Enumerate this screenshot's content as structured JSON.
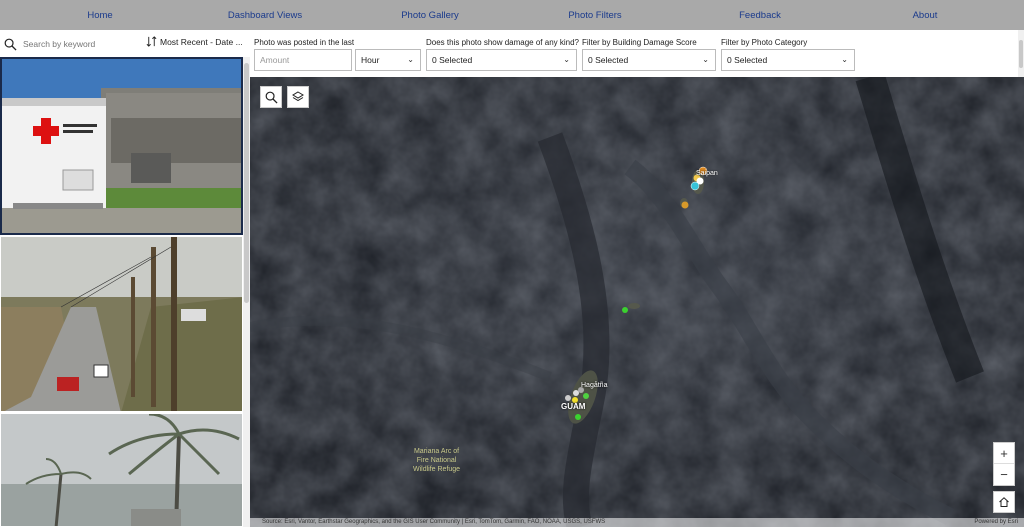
{
  "nav": [
    {
      "label": "Home"
    },
    {
      "label": "Dashboard Views"
    },
    {
      "label": "Photo Gallery"
    },
    {
      "label": "Photo Filters"
    },
    {
      "label": "Feedback"
    },
    {
      "label": "About"
    }
  ],
  "search": {
    "placeholder": "Search by keyword"
  },
  "sort": {
    "label": "Most Recent - Date ..."
  },
  "filters": {
    "posted_label": "Photo was posted in the last",
    "amount_placeholder": "Amount",
    "unit_value": "Hour",
    "damage_label": "Does this photo show damage of any kind?",
    "damage_value": "0 Selected",
    "score_label": "Filter by Building Damage Score",
    "score_value": "0 Selected",
    "category_label": "Filter by Photo Category",
    "category_value": "0 Selected"
  },
  "map": {
    "labels": {
      "saipan": "Saipan",
      "hagatna": "Hagåtña",
      "guam": "GUAM",
      "refuge_line1": "Mariana Arc of",
      "refuge_line2": "Fire National",
      "refuge_line3": "Wildlife Refuge"
    },
    "attribution": "Source: Esri, Vantor, Earthstar Geographics, and the GIS User Community | Esri, TomTom, Garmin, FAO, NOAA, USGS, USFWS",
    "powered_by": "Powered by Esri",
    "zoom_in": "+",
    "zoom_out": "−"
  },
  "colors": {
    "nav_bg": "#a9a9a9",
    "nav_text": "#1a3a8c",
    "map_bg": "#1d2128"
  }
}
